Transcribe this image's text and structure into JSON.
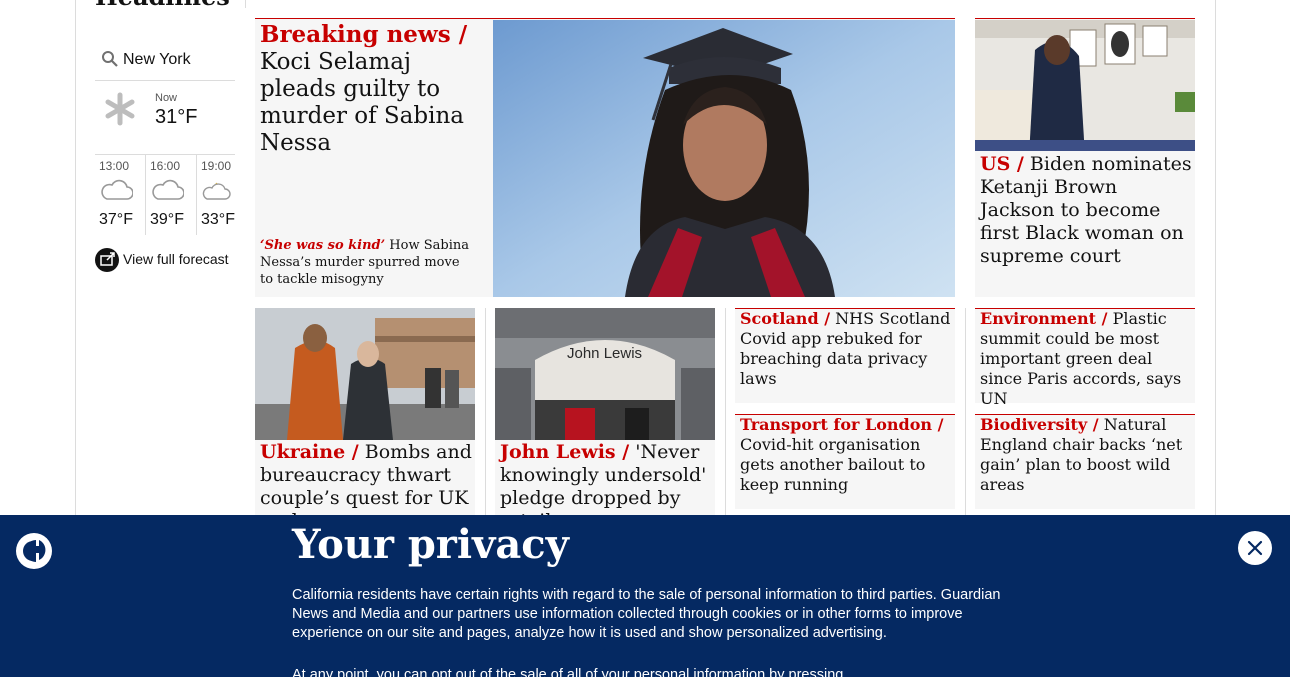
{
  "headlines_title": "Headlines",
  "weather": {
    "location": "New York",
    "now_label": "Now",
    "now_temp": "31°F",
    "forecast": [
      {
        "time": "13:00",
        "temp": "37°F"
      },
      {
        "time": "16:00",
        "temp": "39°F"
      },
      {
        "time": "19:00",
        "temp": "33°F"
      }
    ],
    "view_forecast": "View full forecast"
  },
  "main_story": {
    "kicker": "Breaking news /",
    "headline": "Koci Selamaj pleads guilty to murder of Sabina Nessa",
    "sub_kicker": "‘She was so kind’",
    "sub_headline": "How Sabina Nessa’s murder spurred move to tackle misogyny"
  },
  "side_story": {
    "kicker": "US  /",
    "headline": "Biden nominates Ketanji Brown Jackson to become first Black woman on supreme court"
  },
  "stories": [
    {
      "kicker": "Ukraine /",
      "headline": "Bombs and bureaucracy thwart couple’s quest for UK asylum"
    },
    {
      "kicker": "John Lewis /",
      "headline": "'Never knowingly undersold' pledge dropped by retailer"
    },
    {
      "kicker": "Scotland /",
      "headline": "NHS Scotland Covid app rebuked for breaching data privacy laws"
    },
    {
      "kicker": "Environment /",
      "headline": "Plastic summit could be most important green deal since Paris accords, says UN"
    },
    {
      "kicker": "Transport for London /",
      "headline": "Covid-hit organisation gets another bailout to keep running"
    },
    {
      "kicker": "Biodiversity /",
      "headline": "Natural England chair backs ‘net gain’ plan to boost wild areas"
    }
  ],
  "photo_sign": "John Lewis",
  "privacy": {
    "title": "Your privacy",
    "text": "California residents have certain rights with regard to the sale of personal information to third parties. Guardian News and Media and our partners use information collected through cookies or in other forms to improve experience on our site and pages, analyze how it is used and show personalized advertising.",
    "more": "At any point, you can opt out of the sale of all of your personal information by pressing"
  },
  "colors": {
    "brand_blue": "#052962",
    "news_red": "#c70000",
    "card_bg": "#f6f6f6"
  }
}
